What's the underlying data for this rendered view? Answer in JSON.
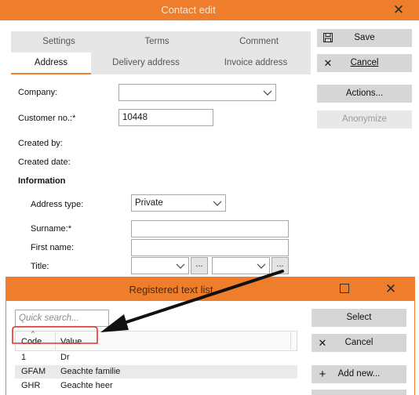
{
  "window": {
    "title": "Contact edit"
  },
  "tabs": {
    "row1": [
      "Settings",
      "Terms",
      "Comment"
    ],
    "row2": [
      "Address",
      "Delivery address",
      "Invoice address"
    ]
  },
  "buttons": {
    "save": "Save",
    "cancel": "Cancel",
    "actions": "Actions...",
    "anonymize": "Anonymize"
  },
  "form": {
    "company_label": "Company:",
    "company_value": "",
    "customer_no_label": "Customer no.:*",
    "customer_no_value": "10448",
    "created_by_label": "Created by:",
    "created_date_label": "Created date:",
    "information_heading": "Information",
    "address_type_label": "Address type:",
    "address_type_value": "Private",
    "surname_label": "Surname:*",
    "first_name_label": "First name:",
    "title_label": "Title:",
    "dots_label": "..."
  },
  "dialog": {
    "title": "Registered text list",
    "search_placeholder": "Quick search...",
    "select_label": "Select",
    "cancel_label": "Cancel",
    "add_new_label": "Add new...",
    "columns": [
      "Code",
      "Value"
    ],
    "rows": [
      {
        "code": "1",
        "value": "Dr"
      },
      {
        "code": "GFAM",
        "value": "Geachte familie"
      },
      {
        "code": "GHR",
        "value": "Geachte heer"
      }
    ]
  },
  "colors": {
    "accent": "#ee7d2c",
    "annotation": "#e8302a"
  }
}
